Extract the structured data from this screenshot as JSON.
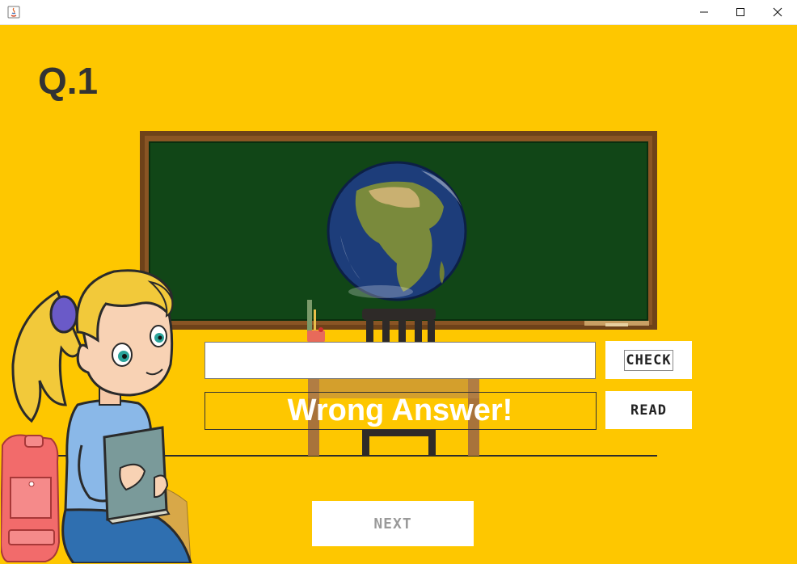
{
  "window": {
    "title": "",
    "controls": {
      "minimize": "minimize",
      "maximize": "maximize",
      "close": "close"
    }
  },
  "question": {
    "number": "Q.1"
  },
  "answer": {
    "value": "",
    "placeholder": ""
  },
  "buttons": {
    "check": "CHECK",
    "read": "READ",
    "next": "NEXT"
  },
  "result": {
    "text": "Wrong Answer!"
  },
  "colors": {
    "background": "#fec700",
    "chalkboard": "#114617",
    "frame": "#6b3f17",
    "text_dark": "#333333"
  },
  "icons": [
    "java-app-icon",
    "minimize-icon",
    "maximize-icon",
    "close-icon"
  ]
}
